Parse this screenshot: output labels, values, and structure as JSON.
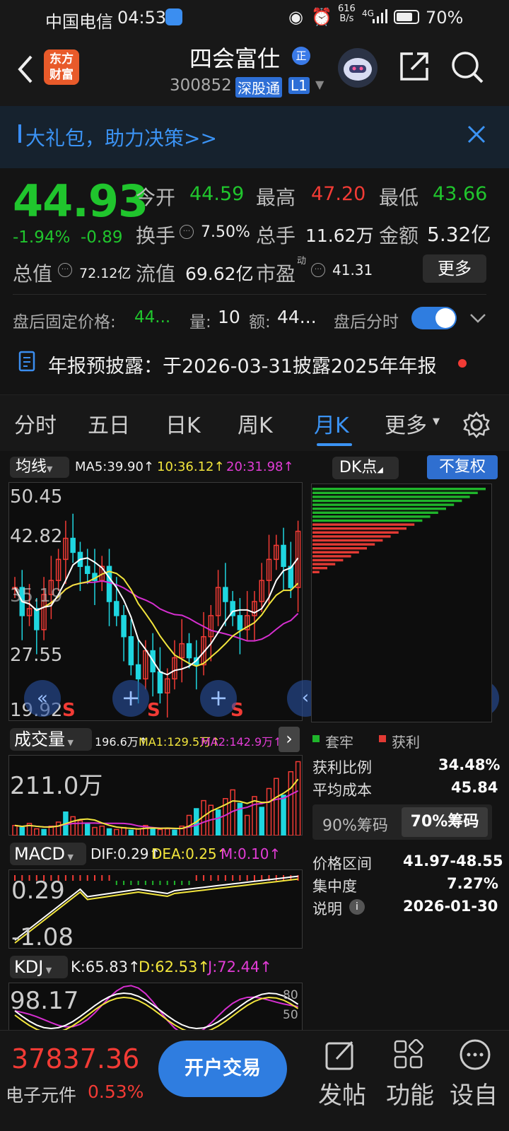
{
  "status_bar": {
    "carrier": "中国电信",
    "time": "04:53",
    "net_speed_top": "616",
    "net_speed_unit": "B/s",
    "signal": "4G",
    "battery": "70%"
  },
  "header": {
    "title": "四会富仕",
    "title_badge": "正",
    "code": "300852",
    "tag1": "深股通",
    "tag2": "L1",
    "logo_line1": "东方",
    "logo_line2": "财富"
  },
  "banner": {
    "text": "大礼包，助力决策>>"
  },
  "quote": {
    "price": "44.93",
    "change_pct": "-1.94%",
    "change_amt": "-0.89",
    "open_label": "今开",
    "open": "44.59",
    "high_label": "最高",
    "high": "47.20",
    "low_label": "最低",
    "low": "43.66",
    "turnover_label": "换手",
    "turnover": "7.50%",
    "volume_label": "总手",
    "volume": "11.62万",
    "amount_label": "金额",
    "amount": "5.32亿",
    "mcap_label": "总值",
    "mcap": "72.12亿",
    "float_label": "流值",
    "float_cap": "69.62亿",
    "pe_label": "市盈",
    "pe_sup": "动",
    "pe": "41.31",
    "more_btn": "更多",
    "after_price_label": "盘后固定价格:",
    "after_price": "44...",
    "after_vol_label": "量:",
    "after_vol": "10",
    "after_amt_label": "额:",
    "after_amt": "44...",
    "after_toggle_label": "盘后分时"
  },
  "notice": {
    "text": "年报预披露：于2026-03-31披露2025年年报"
  },
  "tabs": [
    "分时",
    "五日",
    "日K",
    "周K",
    "月K",
    "更多"
  ],
  "active_tab": "月K",
  "chart_header": {
    "ma_label": "均线",
    "ma5": "MA5:39.90↑",
    "ma10": "10:36.12↑",
    "ma20": "20:31.98↑",
    "dk_label": "DK点",
    "adjust_btn": "不复权"
  },
  "kline_axis": {
    "p1": "50.45",
    "p2": "42.82",
    "p3": "35.19",
    "p4": "27.55",
    "p5": "19.92"
  },
  "markers": [
    "S",
    "S",
    "S"
  ],
  "volume_header": {
    "label": "成交量",
    "vol": "196.6万↑",
    "ma1": "MA1:129.5万↑",
    "ma2": "MA2:142.9万↑",
    "axis": "211.0万"
  },
  "macd_header": {
    "label": "MACD",
    "dif": "DIF:0.29↑",
    "dea": "DEA:0.25↑",
    "m": "M:0.10↑",
    "axis_top": "0.29",
    "axis_bottom": "-1.08"
  },
  "kdj_header": {
    "label": "KDJ",
    "k": "K:65.83↑",
    "d": "D:62.53↑",
    "j": "J:72.44↑",
    "axis": "98.17",
    "r1": "80",
    "r2": "50"
  },
  "chip": {
    "legend_trapped": "套牢",
    "legend_profit": "获利",
    "profit_ratio_label": "获利比例",
    "profit_ratio": "34.48%",
    "avg_cost_label": "平均成本",
    "avg_cost": "45.84",
    "tab90": "90%筹码",
    "tab70": "70%筹码",
    "range_label": "价格区间",
    "range": "41.97-48.55",
    "concentration_label": "集中度",
    "concentration": "7.27%",
    "note_label": "说明",
    "date": "2026-01-30"
  },
  "bottom": {
    "index_value": "37837.36",
    "sector": "电子元件",
    "sector_pct": "0.53%",
    "trade_btn": "开户交易",
    "post": "发帖",
    "func": "功能",
    "settings": "设自"
  }
}
